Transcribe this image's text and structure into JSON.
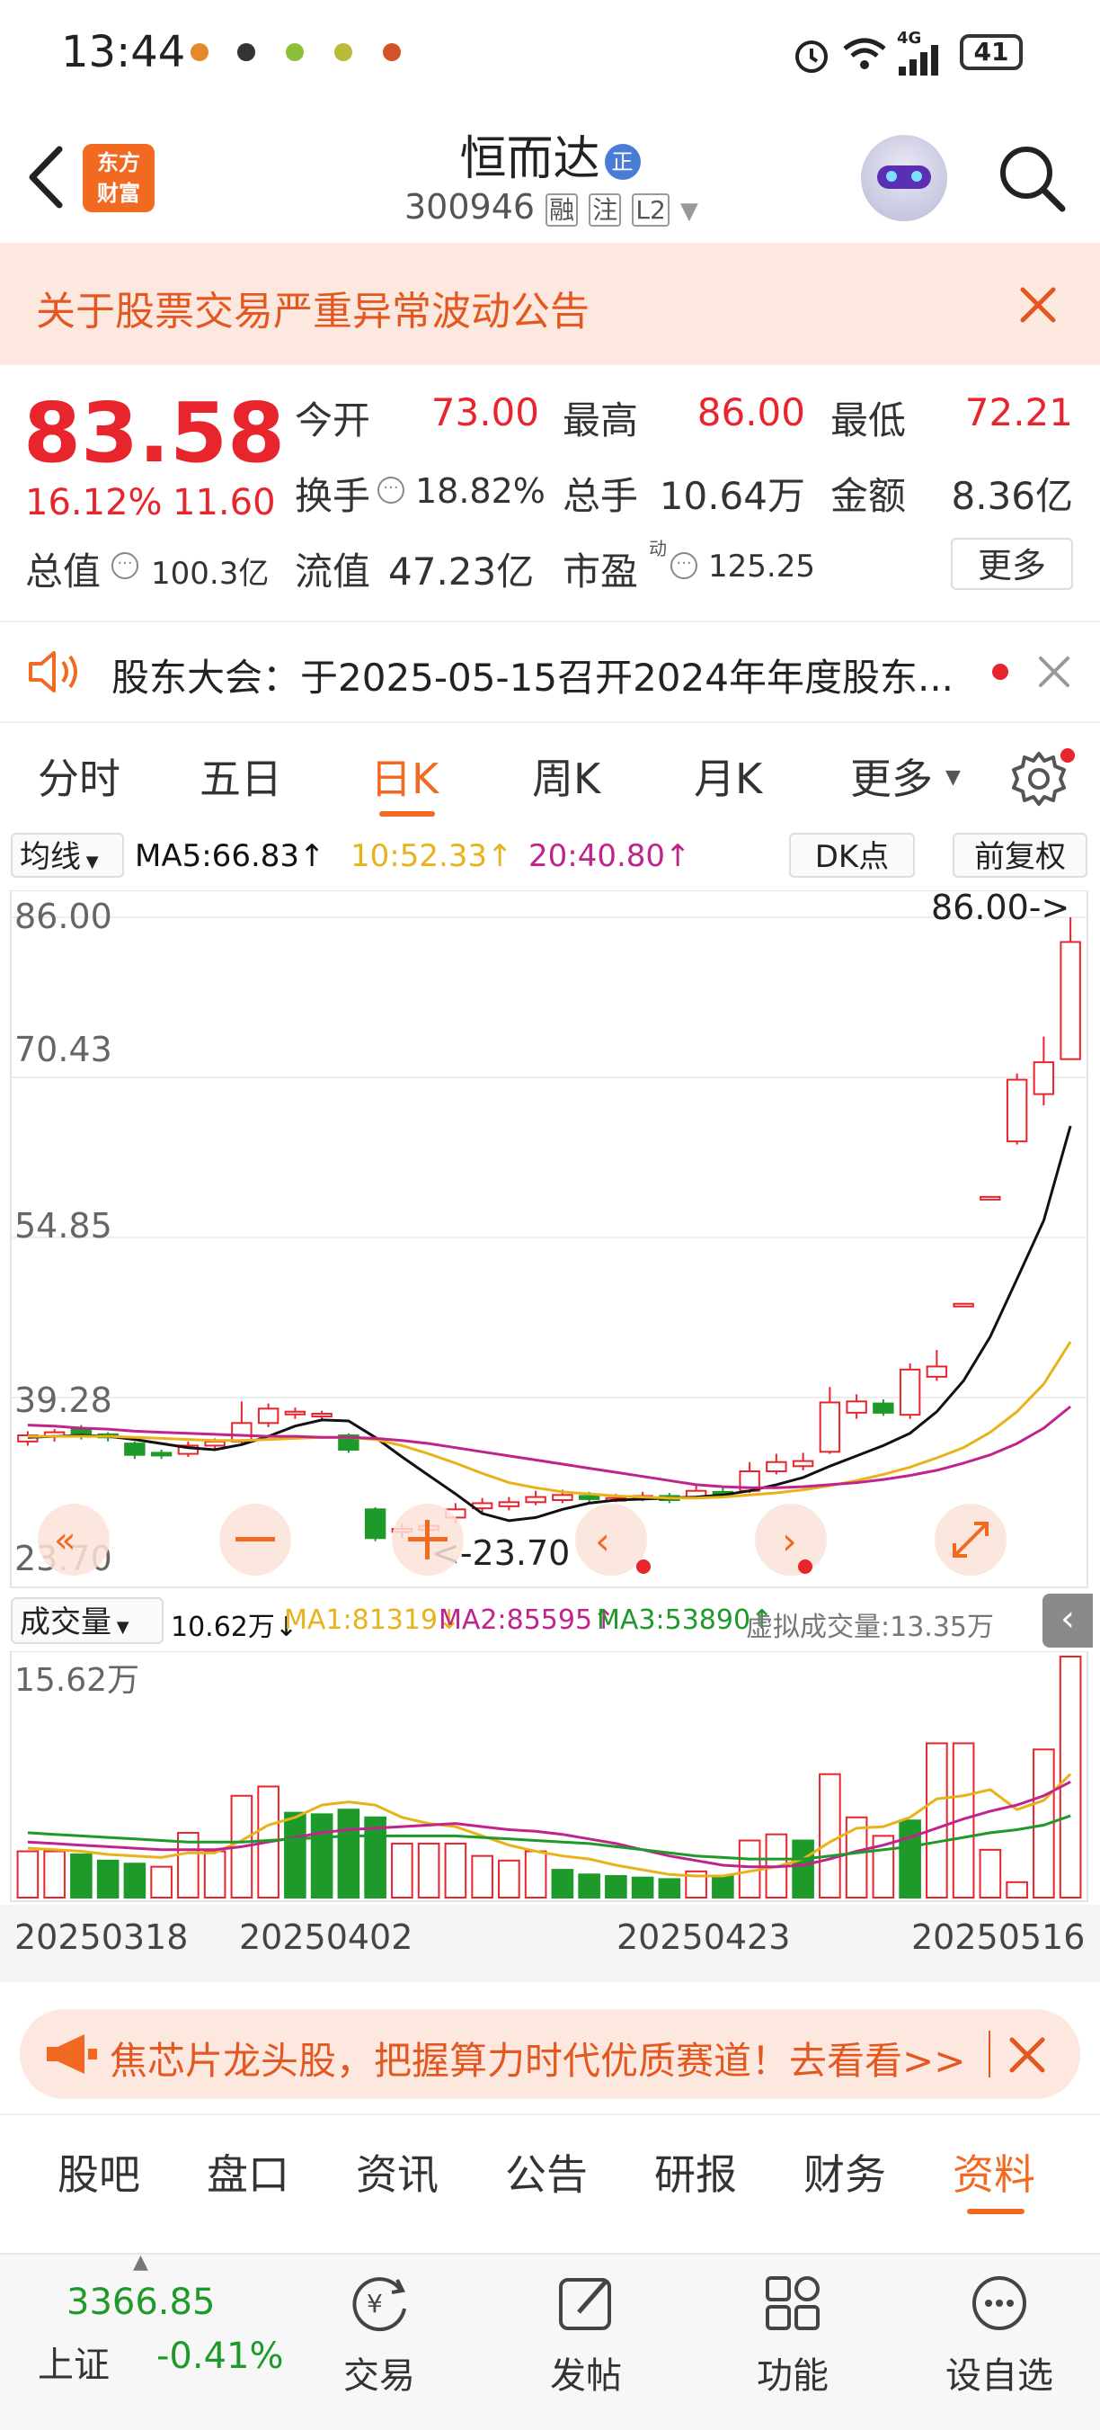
{
  "status_bar": {
    "time": "13:44",
    "battery": "41",
    "network": "4G"
  },
  "header": {
    "logo_text_1": "东方",
    "logo_text_2": "财富",
    "stock_name": "恒而达",
    "badge": "正",
    "code": "300946",
    "tag1": "融",
    "tag2": "注",
    "tag3": "L2"
  },
  "notice": {
    "text": "关于股票交易严重异常波动公告"
  },
  "quote": {
    "price": "83.58",
    "change_pct": "16.12%",
    "change": "11.60",
    "open_label": "今开",
    "open": "73.00",
    "high_label": "最高",
    "high": "86.00",
    "low_label": "最低",
    "low": "72.21",
    "turnover_label": "换手",
    "turnover": "18.82%",
    "volume_label": "总手",
    "volume": "10.64万",
    "amount_label": "金额",
    "amount": "8.36亿",
    "mktcap_label": "总值",
    "mktcap": "100.3亿",
    "float_label": "流值",
    "float": "47.23亿",
    "pe_label": "市盈",
    "pe_sup": "动",
    "pe": "125.25",
    "more_label": "更多"
  },
  "event": {
    "text": "股东大会：于2025-05-15召开2024年年度股东..."
  },
  "period_tabs": [
    "分时",
    "五日",
    "日K",
    "周K",
    "月K",
    "更多"
  ],
  "active_period": "日K",
  "indicator": {
    "selector": "均线",
    "ma5": "MA5:66.83↑",
    "ma10": "10:52.33↑",
    "ma20": "20:40.80↑",
    "dk": "DK点",
    "adjust": "前复权"
  },
  "price_axis": [
    "86.00",
    "70.43",
    "54.85",
    "39.28",
    "23.70"
  ],
  "high_marker": "86.00->",
  "low_marker": "<-23.70",
  "volume_header": {
    "selector": "成交量",
    "value": "10.62万↓",
    "ma1": "MA1:81319↓",
    "ma2": "MA2:85595↑",
    "ma3": "MA3:53890↑",
    "virtual": "虚拟成交量:13.35万"
  },
  "volume_axis_max": "15.62万",
  "dates": [
    "20250318",
    "20250402",
    "20250423",
    "20250516"
  ],
  "ad": {
    "text": "焦芯片龙头股，把握算力时代优质赛道！去看看>>"
  },
  "bottom_tabs": [
    "股吧",
    "盘口",
    "资讯",
    "公告",
    "研报",
    "财务",
    "资料"
  ],
  "active_bottom_tab": "资料",
  "bottom_nav": {
    "index_value": "3366.85",
    "index_name": "上证",
    "index_change": "-0.41%",
    "items": [
      "交易",
      "发帖",
      "功能",
      "设自选"
    ]
  },
  "colors": {
    "up": "#e8242c",
    "down": "#1e9a2a",
    "accent": "#f26a21",
    "ma5": "#111111",
    "ma10": "#e8b21a",
    "ma20": "#c0248c"
  },
  "chart_data": {
    "type": "candlestick",
    "ylim": [
      23.7,
      86.0
    ],
    "candles": [
      {
        "o": 35.0,
        "c": 35.6,
        "h": 36.0,
        "l": 34.6
      },
      {
        "o": 35.5,
        "c": 35.9,
        "h": 36.2,
        "l": 35.0
      },
      {
        "o": 36.2,
        "c": 35.6,
        "h": 36.6,
        "l": 35.2
      },
      {
        "o": 35.7,
        "c": 35.4,
        "h": 35.9,
        "l": 35.0
      },
      {
        "o": 34.8,
        "c": 33.7,
        "h": 35.0,
        "l": 33.3
      },
      {
        "o": 33.9,
        "c": 33.7,
        "h": 34.2,
        "l": 33.3
      },
      {
        "o": 33.8,
        "c": 34.6,
        "h": 35.0,
        "l": 33.5
      },
      {
        "o": 34.6,
        "c": 35.0,
        "h": 35.3,
        "l": 34.3
      },
      {
        "o": 35.0,
        "c": 36.8,
        "h": 38.9,
        "l": 34.8
      },
      {
        "o": 36.8,
        "c": 38.2,
        "h": 38.7,
        "l": 36.4
      },
      {
        "o": 37.8,
        "c": 37.9,
        "h": 38.3,
        "l": 37.2
      },
      {
        "o": 37.6,
        "c": 37.7,
        "h": 38.0,
        "l": 37.2
      },
      {
        "o": 35.6,
        "c": 34.2,
        "h": 35.8,
        "l": 33.9
      },
      {
        "o": 28.4,
        "c": 25.6,
        "h": 28.6,
        "l": 25.3
      },
      {
        "o": 26.2,
        "c": 26.5,
        "h": 27.0,
        "l": 25.6
      },
      {
        "o": 26.4,
        "c": 26.8,
        "h": 27.2,
        "l": 23.7
      },
      {
        "o": 27.6,
        "c": 28.4,
        "h": 29.0,
        "l": 27.0
      },
      {
        "o": 28.5,
        "c": 29.0,
        "h": 29.5,
        "l": 28.0
      },
      {
        "o": 28.7,
        "c": 29.1,
        "h": 29.6,
        "l": 28.3
      },
      {
        "o": 29.1,
        "c": 29.6,
        "h": 30.2,
        "l": 28.8
      },
      {
        "o": 29.3,
        "c": 29.8,
        "h": 30.3,
        "l": 29.0
      },
      {
        "o": 29.7,
        "c": 29.4,
        "h": 30.1,
        "l": 29.1
      },
      {
        "o": 29.4,
        "c": 29.5,
        "h": 29.9,
        "l": 29.1
      },
      {
        "o": 29.5,
        "c": 29.7,
        "h": 30.1,
        "l": 29.2
      },
      {
        "o": 29.7,
        "c": 29.3,
        "h": 30.0,
        "l": 29.0
      },
      {
        "o": 29.6,
        "c": 30.2,
        "h": 30.8,
        "l": 29.4
      },
      {
        "o": 30.1,
        "c": 30.0,
        "h": 30.5,
        "l": 29.8
      },
      {
        "o": 30.2,
        "c": 32.1,
        "h": 33.0,
        "l": 30.0
      },
      {
        "o": 32.1,
        "c": 33.0,
        "h": 33.8,
        "l": 31.8
      },
      {
        "o": 32.6,
        "c": 33.1,
        "h": 33.9,
        "l": 32.2
      },
      {
        "o": 34.0,
        "c": 38.8,
        "h": 40.3,
        "l": 33.8
      },
      {
        "o": 37.8,
        "c": 38.9,
        "h": 39.6,
        "l": 37.2
      },
      {
        "o": 38.7,
        "c": 37.8,
        "h": 39.1,
        "l": 37.5
      },
      {
        "o": 37.6,
        "c": 42.0,
        "h": 42.6,
        "l": 37.2
      },
      {
        "o": 41.3,
        "c": 42.3,
        "h": 43.9,
        "l": 40.9
      },
      {
        "o": 48.4,
        "c": 48.4,
        "h": 48.4,
        "l": 48.4
      },
      {
        "o": 58.8,
        "c": 58.8,
        "h": 58.8,
        "l": 58.8
      },
      {
        "o": 64.2,
        "c": 70.2,
        "h": 70.8,
        "l": 63.9
      },
      {
        "o": 68.8,
        "c": 71.9,
        "h": 74.4,
        "l": 67.7
      },
      {
        "o": 72.2,
        "c": 83.6,
        "h": 86.0,
        "l": 72.21
      }
    ],
    "ma5": [
      35.4,
      35.5,
      35.6,
      35.5,
      35.2,
      34.8,
      34.4,
      34.2,
      34.7,
      35.5,
      36.5,
      37.1,
      37.0,
      35.4,
      33.5,
      31.7,
      29.9,
      28.0,
      27.3,
      27.6,
      28.4,
      29.0,
      29.3,
      29.4,
      29.5,
      29.6,
      29.8,
      30.2,
      30.8,
      31.5,
      32.6,
      33.6,
      34.6,
      35.8,
      37.9,
      40.9,
      45.2,
      50.8,
      56.5,
      65.7
    ],
    "ma10": [
      35.5,
      35.5,
      35.5,
      35.5,
      35.4,
      35.3,
      35.2,
      35.1,
      35.1,
      35.2,
      35.3,
      35.4,
      35.4,
      35.2,
      34.6,
      33.8,
      32.9,
      31.9,
      31.0,
      30.5,
      30.1,
      29.9,
      29.7,
      29.6,
      29.5,
      29.5,
      29.6,
      29.8,
      30.0,
      30.3,
      30.7,
      31.2,
      31.8,
      32.5,
      33.4,
      34.4,
      35.9,
      37.9,
      40.6,
      44.7
    ],
    "ma20": [
      36.6,
      36.5,
      36.3,
      36.2,
      36.0,
      35.9,
      35.8,
      35.7,
      35.6,
      35.5,
      35.5,
      35.4,
      35.4,
      35.3,
      35.1,
      34.8,
      34.4,
      34.0,
      33.6,
      33.2,
      32.8,
      32.4,
      32.0,
      31.6,
      31.2,
      30.8,
      30.6,
      30.5,
      30.5,
      30.6,
      30.8,
      31.0,
      31.3,
      31.7,
      32.2,
      32.9,
      33.7,
      34.8,
      36.3,
      38.4
    ],
    "volume": {
      "max": 156200,
      "bars": [
        30000,
        30000,
        28000,
        24000,
        22000,
        20000,
        42000,
        30000,
        66000,
        72000,
        55000,
        54000,
        57000,
        52000,
        35000,
        35000,
        35000,
        27000,
        24000,
        30000,
        18000,
        15000,
        14000,
        13000,
        12000,
        17000,
        14000,
        37000,
        41000,
        37000,
        80000,
        52000,
        40000,
        50000,
        100000,
        100000,
        31000,
        10000,
        96000,
        156200
      ],
      "up": [
        true,
        true,
        false,
        false,
        false,
        true,
        true,
        true,
        true,
        true,
        false,
        false,
        false,
        false,
        true,
        true,
        true,
        true,
        true,
        true,
        false,
        false,
        false,
        false,
        false,
        true,
        false,
        true,
        true,
        false,
        true,
        true,
        true,
        false,
        true,
        true,
        true,
        true,
        true,
        true
      ],
      "ma1": [
        32000,
        31000,
        30000,
        28000,
        27000,
        26000,
        29000,
        29000,
        37000,
        47000,
        52000,
        60000,
        62000,
        60000,
        52000,
        48000,
        46000,
        40000,
        34000,
        30000,
        27000,
        25000,
        21000,
        18000,
        15000,
        14000,
        14000,
        17000,
        20000,
        25000,
        36000,
        45000,
        46000,
        52000,
        64000,
        66000,
        70000,
        57000,
        63000,
        80000
      ],
      "ma2": [
        36000,
        35000,
        34000,
        33000,
        32000,
        31000,
        31000,
        31000,
        33000,
        36000,
        39000,
        42000,
        44000,
        45000,
        46000,
        47000,
        48000,
        46000,
        44000,
        43000,
        41000,
        38000,
        35000,
        31000,
        27000,
        24000,
        21000,
        20000,
        20000,
        21000,
        25000,
        30000,
        34000,
        39000,
        45000,
        51000,
        56000,
        60000,
        66000,
        75000
      ],
      "ma3": [
        42000,
        41000,
        40000,
        39000,
        38000,
        37000,
        36000,
        36000,
        36000,
        37000,
        38000,
        39000,
        40000,
        40000,
        40000,
        40000,
        40000,
        39000,
        38000,
        37000,
        36000,
        35000,
        33000,
        31000,
        29000,
        27000,
        26000,
        25000,
        25000,
        25000,
        27000,
        29000,
        31000,
        33000,
        36000,
        39000,
        42000,
        44000,
        47000,
        53000
      ]
    }
  }
}
